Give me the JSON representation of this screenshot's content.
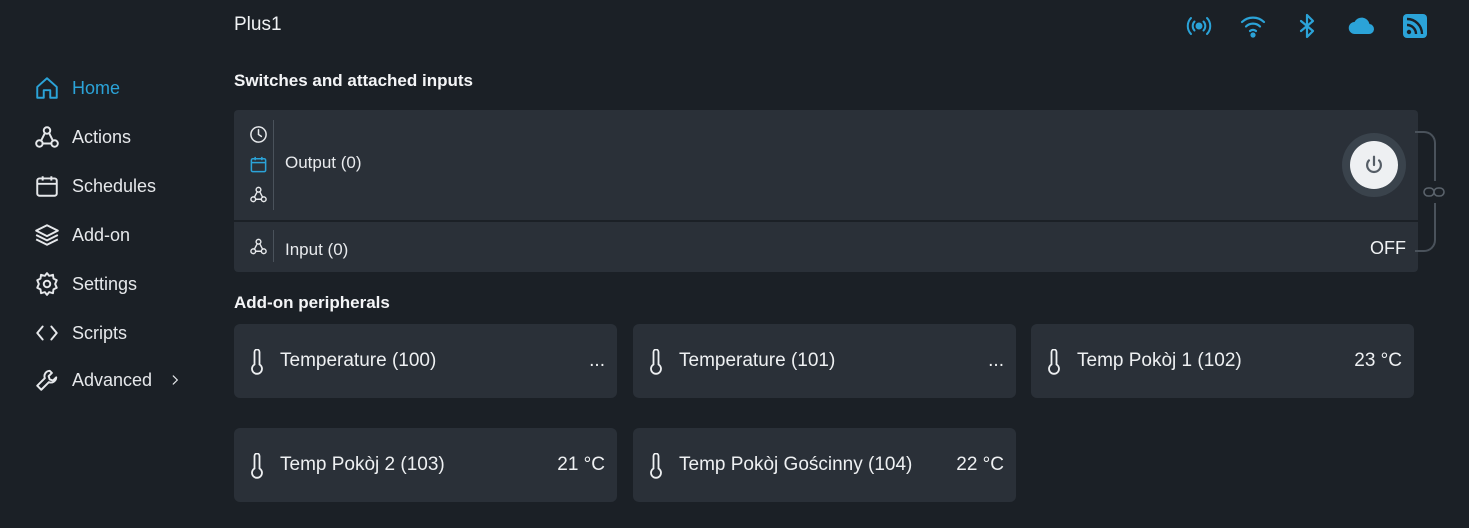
{
  "header": {
    "device_name": "Plus1"
  },
  "status_icons": [
    "broadcast-icon",
    "wifi-icon",
    "bluetooth-icon",
    "cloud-icon",
    "rss-icon"
  ],
  "colors": {
    "accent": "#2ba3d8",
    "background": "#1b2026",
    "card": "#2a3038"
  },
  "sidebar": {
    "items": [
      {
        "label": "Home",
        "icon": "home-icon",
        "active": true
      },
      {
        "label": "Actions",
        "icon": "webhook-icon"
      },
      {
        "label": "Schedules",
        "icon": "calendar-icon"
      },
      {
        "label": "Add-on",
        "icon": "layers-icon"
      },
      {
        "label": "Settings",
        "icon": "gear-icon"
      },
      {
        "label": "Scripts",
        "icon": "code-icon"
      },
      {
        "label": "Advanced",
        "icon": "wrench-icon"
      }
    ]
  },
  "switches": {
    "title": "Switches and attached inputs",
    "output_label": "Output (0)",
    "input_label": "Input (0)",
    "input_state": "OFF"
  },
  "peripherals": {
    "title": "Add-on peripherals",
    "items": [
      {
        "label": "Temperature (100)",
        "value": "..."
      },
      {
        "label": "Temperature (101)",
        "value": "..."
      },
      {
        "label": "Temp Pokòj 1 (102)",
        "value": "23 °C"
      },
      {
        "label": "Temp Pokòj 2 (103)",
        "value": "21 °C"
      },
      {
        "label": "Temp Pokòj Gościnny (104)",
        "value": "22 °C"
      }
    ]
  }
}
